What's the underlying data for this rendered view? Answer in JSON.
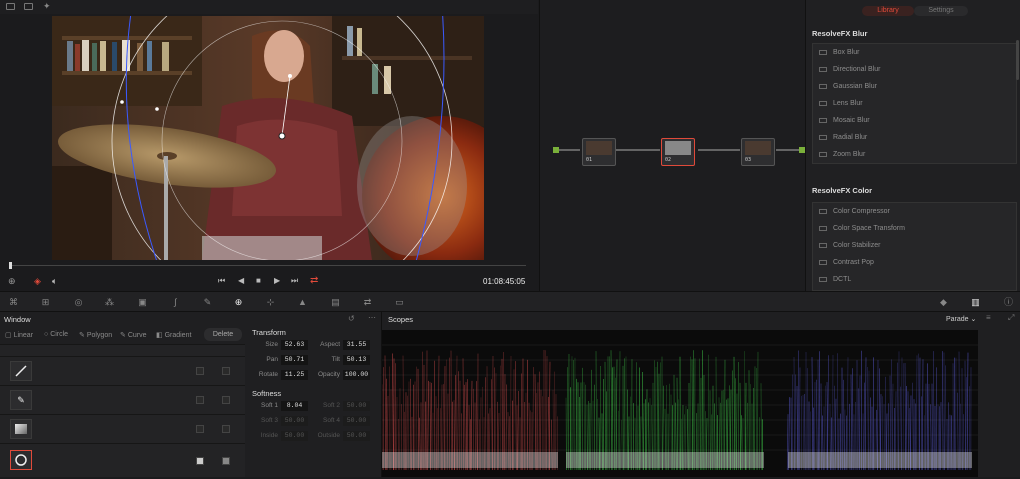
{
  "viewer": {
    "timecode": "01:08:45:05"
  },
  "nodes": [
    {
      "label": "01"
    },
    {
      "label": "02"
    },
    {
      "label": "03"
    }
  ],
  "library": {
    "tabs": [
      "Library",
      "Settings"
    ],
    "active_tab": "Library",
    "sections": [
      {
        "title": "ResolveFX Blur",
        "items": [
          "Box Blur",
          "Directional Blur",
          "Gaussian Blur",
          "Lens Blur",
          "Mosaic Blur",
          "Radial Blur",
          "Zoom Blur"
        ]
      },
      {
        "title": "ResolveFX Color",
        "items": [
          "Color Compressor",
          "Color Space Transform",
          "Color Stabilizer",
          "Contrast Pop",
          "DCTL"
        ]
      }
    ]
  },
  "window_panel": {
    "title": "Window",
    "shapes": [
      "Linear",
      "Circle",
      "Polygon",
      "Curve",
      "Gradient"
    ],
    "delete_label": "Delete",
    "transform": {
      "title": "Transform",
      "fields": [
        {
          "label": "Size",
          "value": "52.63"
        },
        {
          "label": "Aspect",
          "value": "31.55"
        },
        {
          "label": "Pan",
          "value": "50.71"
        },
        {
          "label": "Tilt",
          "value": "50.13"
        },
        {
          "label": "Rotate",
          "value": "11.25"
        },
        {
          "label": "Opacity",
          "value": "100.00"
        }
      ]
    },
    "softness": {
      "title": "Softness",
      "fields": [
        {
          "label": "Soft 1",
          "value": "8.04"
        },
        {
          "label": "Soft 2",
          "value": "50.00"
        },
        {
          "label": "Soft 3",
          "value": "50.00"
        },
        {
          "label": "Soft 4",
          "value": "50.00"
        },
        {
          "label": "Inside",
          "value": "50.00"
        },
        {
          "label": "Outside",
          "value": "50.00"
        }
      ]
    }
  },
  "scopes": {
    "title": "Scopes",
    "mode": "Parade"
  },
  "colors": {
    "accent": "#e04a3a",
    "parade_red": "#ff5a5a",
    "parade_green": "#4dff5a",
    "parade_blue": "#6a6aff"
  }
}
